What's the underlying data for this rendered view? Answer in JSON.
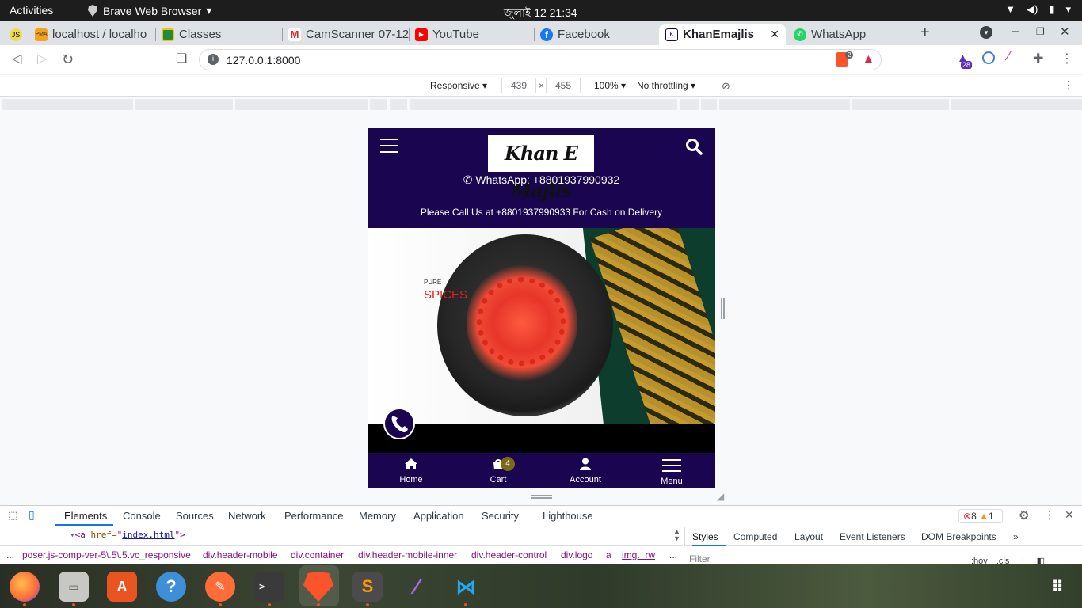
{
  "gnome": {
    "activities": "Activities",
    "app_name": "Brave Web Browser",
    "clock": "জুলাই 12  21:34"
  },
  "tabs": [
    {
      "label": "localhost / localho",
      "icon": "phpmyadmin-icon",
      "favicon_text": "PMA"
    },
    {
      "label": "Classes",
      "icon": "google-classroom-icon"
    },
    {
      "label": "CamScanner 07-12",
      "icon": "gmail-icon",
      "favicon_text": "M"
    },
    {
      "label": "YouTube",
      "icon": "youtube-icon"
    },
    {
      "label": "Facebook",
      "icon": "facebook-icon",
      "favicon_text": "f"
    },
    {
      "label": "KhanEmajlis",
      "icon": "site-favicon-icon",
      "active": true
    },
    {
      "label": "WhatsApp",
      "icon": "whatsapp-icon"
    }
  ],
  "first_tab_favicon": "JS",
  "toolbar": {
    "url": "127.0.0.1:8000",
    "shields_count": "2",
    "extension_badge": "28"
  },
  "devbar": {
    "device": "Responsive",
    "width": "439",
    "times": "×",
    "height": "455",
    "zoom": "100%",
    "throttle": "No throttling"
  },
  "site": {
    "logo_text": "Khan E Majlis",
    "whatsapp": "WhatsApp: +8801937990932",
    "cod_notice": "Please Call Us at +8801937990933 For Cash on Delivery",
    "hero_small": "PURE",
    "hero_big": "SPICES",
    "nav": [
      {
        "label": "Home",
        "icon": "home-icon"
      },
      {
        "label": "Cart",
        "icon": "cart-icon"
      },
      {
        "label": "Account",
        "icon": "account-icon"
      },
      {
        "label": "Menu",
        "icon": "menu-icon"
      }
    ],
    "cart_count": "4"
  },
  "devtools": {
    "tabs": [
      "Elements",
      "Console",
      "Sources",
      "Network",
      "Performance",
      "Memory",
      "Application",
      "Security",
      "Lighthouse"
    ],
    "errors": "8",
    "warnings": "1",
    "dom_tag_open": "<a",
    "dom_attr": " href=",
    "dom_quote_open": "\"",
    "dom_value": "index.html",
    "dom_quote_close": "\">",
    "breadcrumbs": [
      "...",
      "poser.js-comp-ver-5\\.5\\.5.vc_responsive",
      "div.header-mobile",
      "div.container",
      "div.header-mobile-inner",
      "div.header-control",
      "div.logo",
      "a",
      "img._rw",
      "..."
    ],
    "styles_tabs": [
      "Styles",
      "Computed",
      "Layout",
      "Event Listeners",
      "DOM Breakpoints",
      "»"
    ],
    "filter_placeholder": "Filter",
    "hov": ":hov",
    "cls": ".cls",
    "plus": "+"
  },
  "dock": [
    {
      "name": "firefox"
    },
    {
      "name": "files"
    },
    {
      "name": "software-center"
    },
    {
      "name": "help"
    },
    {
      "name": "postman"
    },
    {
      "name": "terminal"
    },
    {
      "name": "brave"
    },
    {
      "name": "sublime-text"
    },
    {
      "name": "feather-app"
    },
    {
      "name": "vscode"
    },
    {
      "name": "app-grid"
    }
  ],
  "colors": {
    "site_header": "#1a0550",
    "hero_accent": "#e0201b",
    "cart_badge": "#7b6a18"
  }
}
